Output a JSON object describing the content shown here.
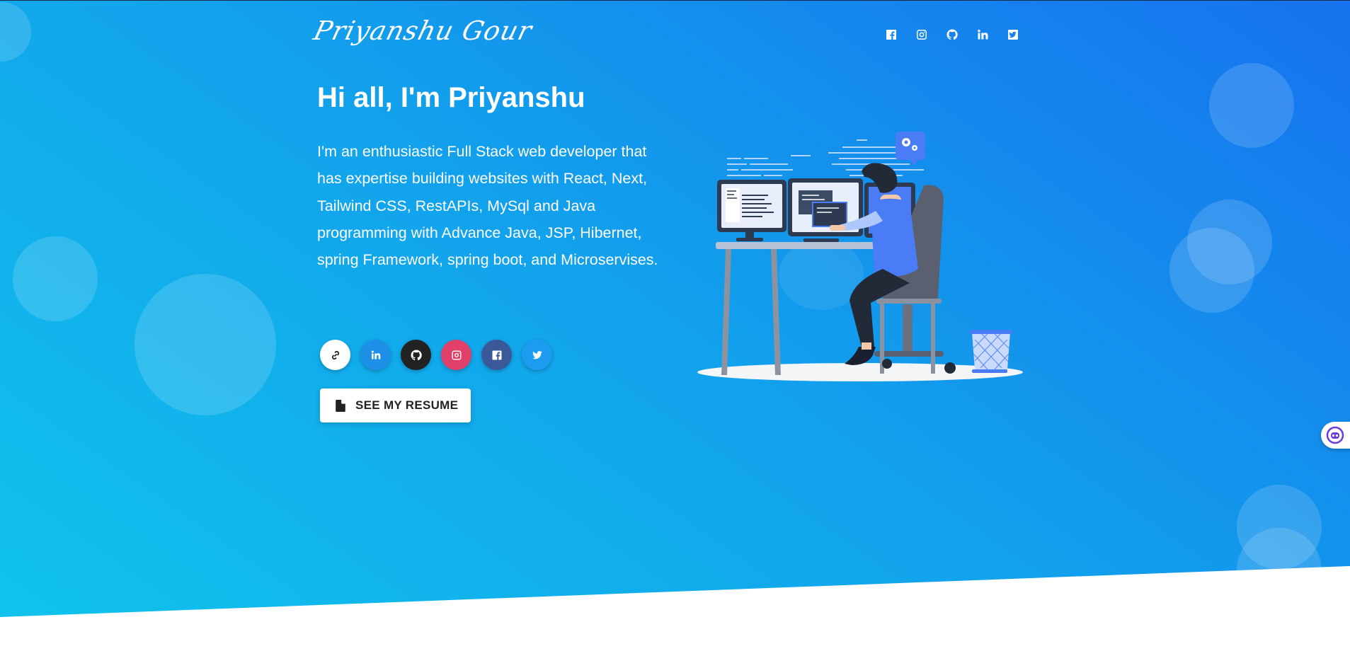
{
  "header": {
    "logo_text": "Priyanshu Gour",
    "nav_icons": [
      "facebook-icon",
      "instagram-icon",
      "github-icon",
      "linkedin-icon",
      "twitter-icon"
    ]
  },
  "hero": {
    "greeting": "Hi all, I'm Priyanshu",
    "intro": "I'm an enthusiastic Full Stack web developer that has expertise building websites with React, Next, Tailwind CSS, RestAPIs, MySql and Java programming with Advance Java, JSP, Hibernet, spring Framework, spring boot, and Microservises.",
    "socials": [
      {
        "icon": "link-icon",
        "bg": "#ffffff",
        "fg": "#222222"
      },
      {
        "icon": "linkedin-icon",
        "bg": "#1e90e8",
        "fg": "#ffffff"
      },
      {
        "icon": "github-icon",
        "bg": "#222222",
        "fg": "#ffffff"
      },
      {
        "icon": "instagram-icon",
        "bg": "#e1406a",
        "fg": "#ffffff"
      },
      {
        "icon": "facebook-icon",
        "bg": "#3b5998",
        "fg": "#ffffff"
      },
      {
        "icon": "twitter-icon",
        "bg": "#1d9bf0",
        "fg": "#ffffff"
      }
    ],
    "resume_label": "SEE MY RESUME"
  },
  "colors": {
    "gradient_start": "#1672ee",
    "gradient_end": "#10c5ec",
    "accent_blue": "#4a7cf6"
  },
  "chat_widget_icon": "chat-bot-icon"
}
